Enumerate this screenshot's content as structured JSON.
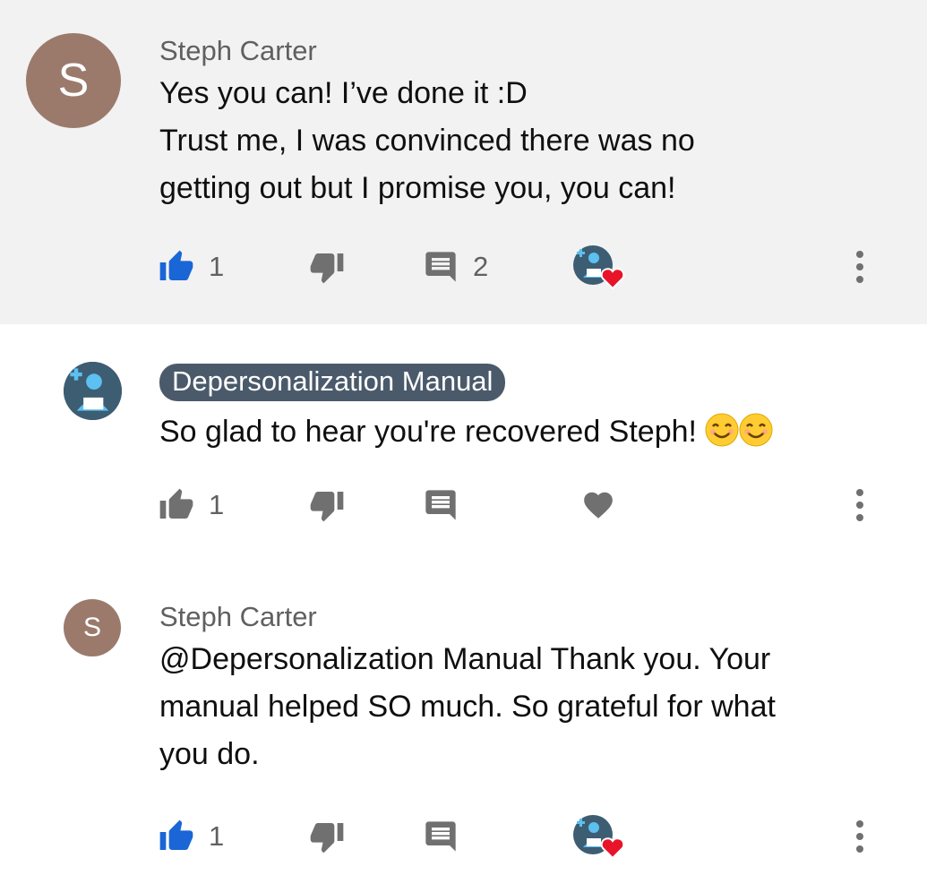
{
  "colors": {
    "like_active": "#1a66d6",
    "icon_inactive": "#707070",
    "heart_red": "#e8142a",
    "avatar_letter_bg": "#9b7a6c",
    "channel_avatar_bg": "#3d5d73",
    "highlight_bg": "#f2f2f2"
  },
  "comments": [
    {
      "author": "Steph Carter",
      "avatar_letter": "S",
      "lines": [
        "Yes you can! I’ve done it :D",
        "Trust me, I was convinced there was no",
        "getting out but I promise you, you can!"
      ],
      "like_count": "1",
      "liked": true,
      "reply_count": "2",
      "creator_heart": true
    },
    {
      "author": "Depersonalization Manual",
      "author_is_creator": true,
      "avatar_icon": "channel-reader-icon",
      "lines": [
        "So glad to hear you're recovered Steph!"
      ],
      "emoji": [
        "smiling-face-emoji",
        "smiling-face-emoji"
      ],
      "like_count": "1",
      "liked": false,
      "creator_heart": false
    },
    {
      "author": "Steph Carter",
      "avatar_letter": "S",
      "lines": [
        "@Depersonalization Manual Thank you. Your",
        "manual helped SO much. So grateful for what",
        "you do."
      ],
      "like_count": "1",
      "liked": true,
      "creator_heart": true
    }
  ]
}
